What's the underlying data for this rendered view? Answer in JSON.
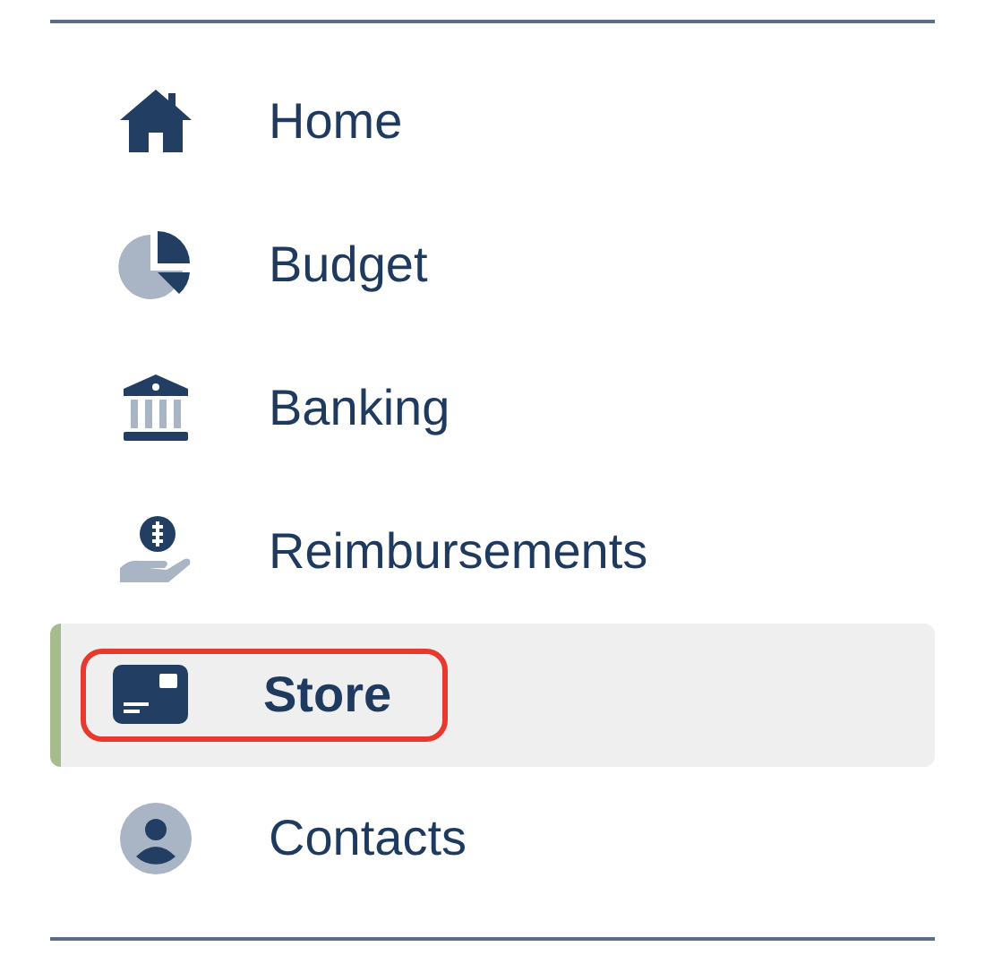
{
  "nav": {
    "items": [
      {
        "kind": "home",
        "label": "Home",
        "selected": false
      },
      {
        "kind": "budget",
        "label": "Budget",
        "selected": false
      },
      {
        "kind": "banking",
        "label": "Banking",
        "selected": false
      },
      {
        "kind": "reimbursements",
        "label": "Reimbursements",
        "selected": false
      },
      {
        "kind": "store",
        "label": "Store",
        "selected": true
      },
      {
        "kind": "contacts",
        "label": "Contacts",
        "selected": false
      }
    ]
  }
}
